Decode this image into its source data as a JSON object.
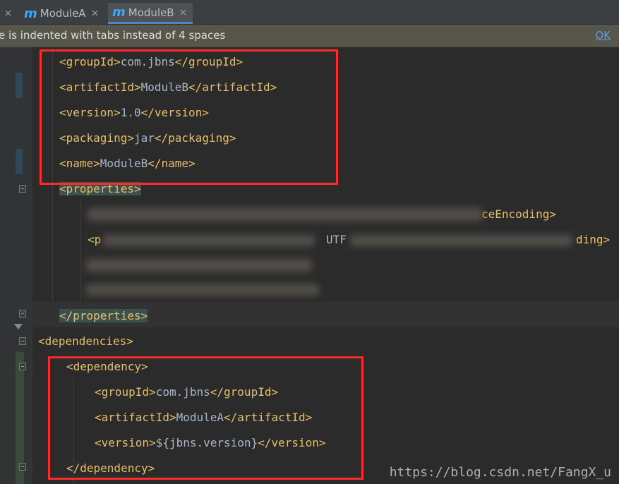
{
  "tabs": [
    {
      "label": "",
      "close": "×",
      "active": false
    },
    {
      "label": "ModuleA",
      "close": "×",
      "active": false
    },
    {
      "label": "ModuleB",
      "close": "×",
      "active": true
    }
  ],
  "tab_icon_letter": "m",
  "notice": {
    "message": "e is indented with tabs instead of 4 spaces",
    "ok_label": "OK"
  },
  "code": {
    "groupId_open": "<groupId>",
    "groupId_val": "com.jbns",
    "groupId_close": "</groupId>",
    "artifactId_open": "<artifactId>",
    "artifactId_val": "ModuleB",
    "artifactId_close": "</artifactId>",
    "version_open": "<version>",
    "version_val": "1.0",
    "version_close": "</version>",
    "packaging_open": "<packaging>",
    "packaging_val": "jar",
    "packaging_close": "</packaging>",
    "name_open": "<name>",
    "name_val": "ModuleB",
    "name_close": "</name>",
    "properties_open": "<properties>",
    "prop1_tail": "ceEncoding>",
    "prop2_head": "<p",
    "prop2_mid": "UTF",
    "prop2_tail": "ding>",
    "properties_close": "</properties>",
    "dependencies_open": "<dependencies>",
    "dependency_open": "<dependency>",
    "dep_groupId_open": "<groupId>",
    "dep_groupId_val": "com.jbns",
    "dep_groupId_close": "</groupId>",
    "dep_artifactId_open": "<artifactId>",
    "dep_artifactId_val": "ModuleA",
    "dep_artifactId_close": "</artifactId>",
    "dep_version_open": "<version>",
    "dep_version_val": "${jbns.version}",
    "dep_version_close": "</version>",
    "dependency_close": "</dependency>"
  },
  "watermark": "https://blog.csdn.net/FangX_u",
  "colors": {
    "tag": "#e8bf6a",
    "text": "#a9b7c6",
    "highlight_box": "#ff2a2a",
    "editor_bg": "#2b2b2b"
  }
}
